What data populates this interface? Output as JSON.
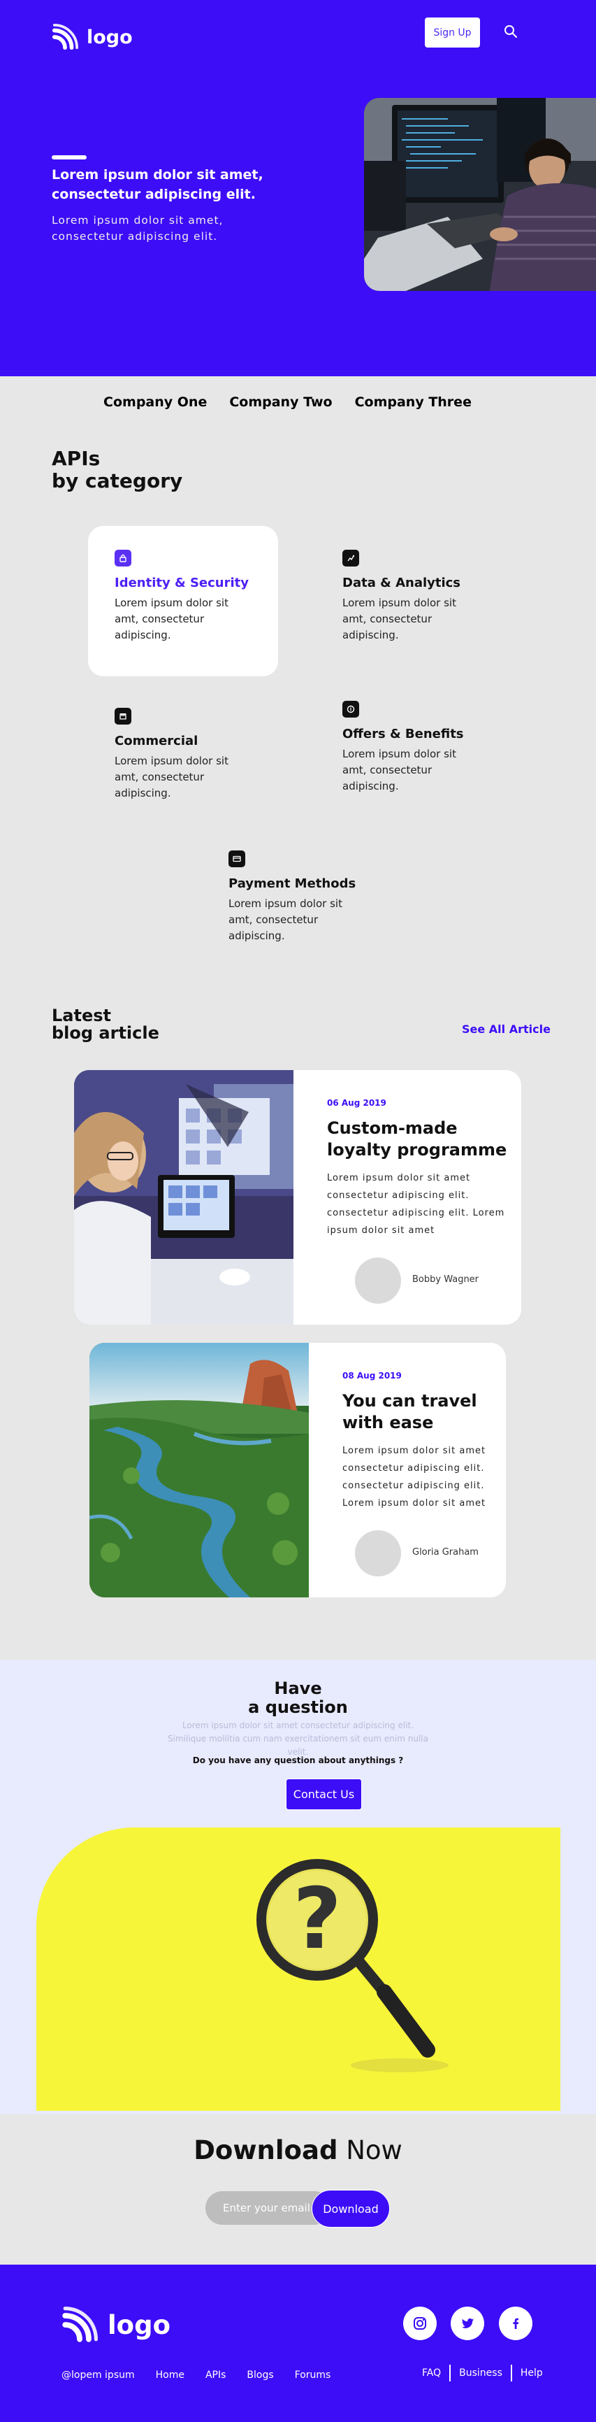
{
  "header": {
    "logo_text": "logo",
    "signup_label": "Sign Up",
    "search_icon": "search-icon"
  },
  "hero": {
    "title": "Lorem ipsum dolor sit amet, consectetur adipiscing elit.",
    "subtitle": "Lorem ipsum dolor sit amet, consectetur adipiscing elit."
  },
  "companies": [
    "Company One",
    "Company Two",
    "Company Three"
  ],
  "apis": {
    "title_line1": "APIs",
    "title_line2": "by category",
    "items": [
      {
        "name": "Identity & Security",
        "desc": "Lorem ipsum dolor sit amt, consectetur adipiscing.",
        "icon": "lock-icon"
      },
      {
        "name": "Data & Analytics",
        "desc": "Lorem ipsum dolor sit amt, consectetur adipiscing.",
        "icon": "analytics-icon"
      },
      {
        "name": "Commercial",
        "desc": "Lorem ipsum dolor sit amt, consectetur adipiscing.",
        "icon": "store-icon"
      },
      {
        "name": "Offers & Benefits",
        "desc": "Lorem ipsum dolor sit amt, consectetur adipiscing.",
        "icon": "coin-icon"
      },
      {
        "name": "Payment Methods",
        "desc": "Lorem ipsum dolor sit amt, consectetur adipiscing.",
        "icon": "card-icon"
      }
    ]
  },
  "blog": {
    "title_line1": "Latest",
    "title_line2": "blog article",
    "see_all": "See All Article",
    "posts": [
      {
        "date": "06 Aug 2019",
        "title": "Custom-made loyalty programme",
        "text": "Lorem ipsum dolor sit amet consectetur adipiscing elit. consectetur adipiscing elit. Lorem ipsum dolor sit amet",
        "author": "Bobby Wagner"
      },
      {
        "date": "08 Aug 2019",
        "title": "You can travel with ease",
        "text": "Lorem ipsum dolor sit amet consectetur adipiscing elit. consectetur adipiscing elit. Lorem ipsum dolor sit amet",
        "author": "Gloria Graham"
      }
    ]
  },
  "question": {
    "title_line1": "Have",
    "title_line2": "a question",
    "faint_text": "Lorem ipsum dolor sit amet consectetur adipiscing elit. Similique mollitia cum nam exercitationem sit eum enim nulla velit.",
    "ask": "Do you have any question about anythings ?",
    "contact_label": "Contact Us"
  },
  "download": {
    "title_bold": "Download",
    "title_rest": "Now",
    "placeholder": "Enter your email",
    "button_label": "Download"
  },
  "footer": {
    "logo_text": "logo",
    "links": [
      "@lopem ipsum",
      "Home",
      "APIs",
      "Blogs",
      "Forums"
    ],
    "right_links": [
      "FAQ",
      "Business",
      "Help"
    ],
    "social_icons": [
      "instagram-icon",
      "twitter-icon",
      "facebook-icon"
    ]
  },
  "colors": {
    "brand": "#3d0df7",
    "page_bg": "#e7e7e7",
    "question_bg": "#e8eafd",
    "yellow": "#f7f53a"
  }
}
